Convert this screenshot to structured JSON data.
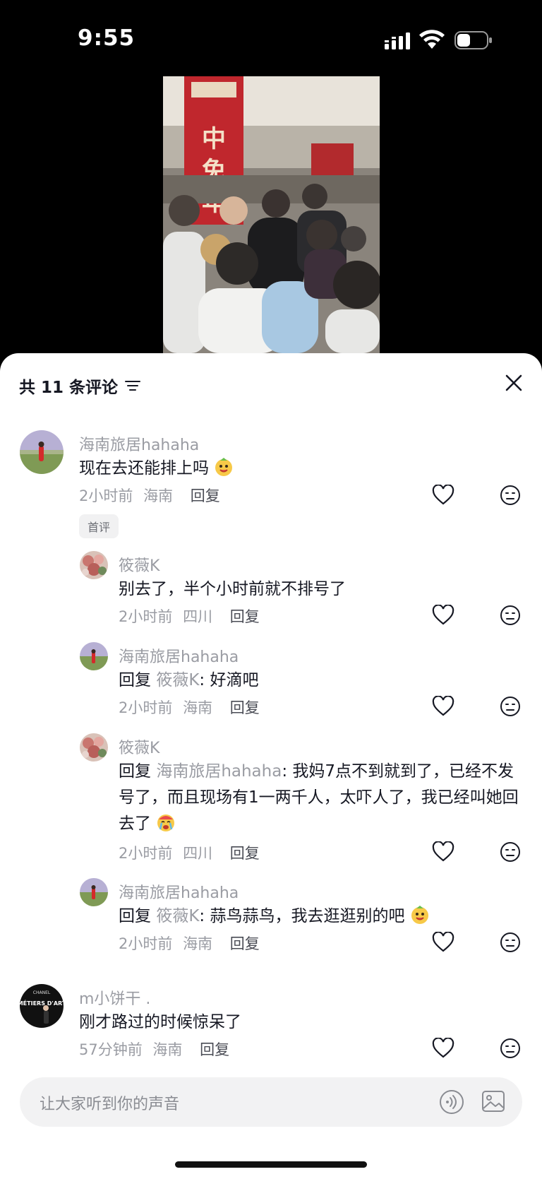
{
  "status_bar": {
    "time": "9:55"
  },
  "sheet": {
    "title": "共 11 条评论"
  },
  "comments": [
    {
      "username": "海南旅居hahaha",
      "text": "现在去还能排上吗",
      "time": "2小时前",
      "location": "海南",
      "reply_label": "回复",
      "badge": "首评",
      "emoji": "smile-emoji"
    },
    {
      "username": "筱薇K",
      "text": "别去了，半个小时前就不排号了",
      "time": "2小时前",
      "location": "四川",
      "reply_label": "回复"
    },
    {
      "username": "海南旅居hahaha",
      "reply_prefix": "回复 ",
      "reply_target": "筱薇K",
      "text": ": 好滴吧",
      "time": "2小时前",
      "location": "海南",
      "reply_label": "回复"
    },
    {
      "username": "筱薇K",
      "reply_prefix": "回复 ",
      "reply_target": "海南旅居hahaha",
      "text": ": 我妈7点不到就到了，已经不发号了，而且现场有1一两千人，太吓人了，我已经叫她回去了",
      "time": "2小时前",
      "location": "四川",
      "reply_label": "回复",
      "emoji": "cry-emoji"
    },
    {
      "username": "海南旅居hahaha",
      "reply_prefix": "回复 ",
      "reply_target": "筱薇K",
      "text": ": 蒜鸟蒜鸟，我去逛逛别的吧",
      "time": "2小时前",
      "location": "海南",
      "reply_label": "回复",
      "emoji": "smile-emoji"
    },
    {
      "username": "m小饼干 .",
      "text": "刚才路过的时候惊呆了",
      "time": "57分钟前",
      "location": "海南",
      "reply_label": "回复"
    }
  ],
  "input": {
    "placeholder": "让大家听到你的声音"
  },
  "video": {
    "banner_text": "中免年"
  },
  "avatar_text": {
    "brand": "CHANEL",
    "title": "MÉTIERS D'ART"
  },
  "colors": {
    "accent": "#161823",
    "muted": "#9a9ca3",
    "banner_red": "#c0272d"
  }
}
